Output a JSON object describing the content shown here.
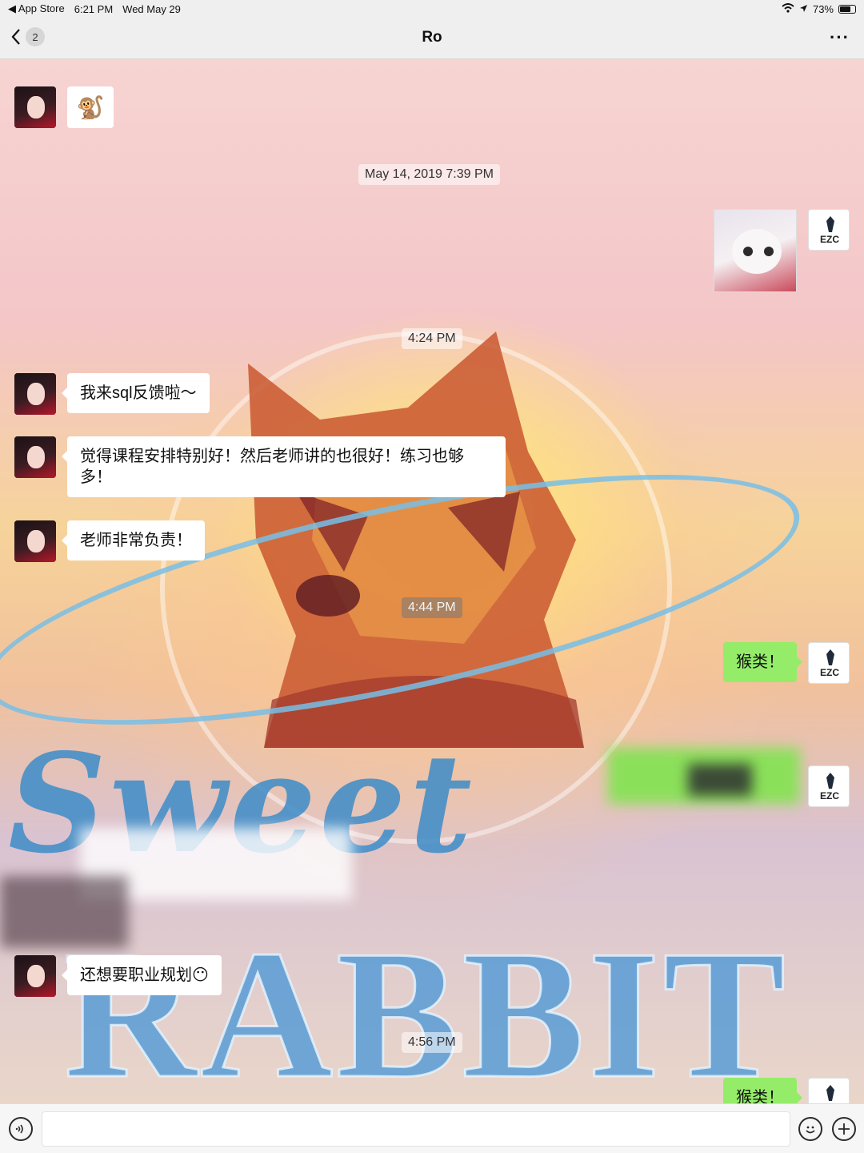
{
  "status_bar": {
    "back_app": "App Store",
    "time": "6:21 PM",
    "date": "Wed May 29",
    "battery": "73%",
    "battery_level": 0.73
  },
  "nav": {
    "title": "Ro",
    "unread_badge": "2",
    "more_label": "···"
  },
  "messages": {
    "sticker_1": "🐒",
    "timestamp_1": "May 14, 2019 7:39 PM",
    "timestamp_2": "4:24 PM",
    "msg_1": "我来sql反馈啦～",
    "msg_2": "觉得课程安排特别好！然后老师讲的也很好！练习也够多！",
    "msg_3": "老师非常负责！",
    "timestamp_3": "4:44 PM",
    "msg_4": "猴类！",
    "msg_5": "还想要职业规划😶",
    "timestamp_4": "4:56 PM",
    "msg_6": "猴类！",
    "my_avatar_text": "EZC"
  },
  "background": {
    "word_1": "Sweet",
    "word_2": "RABBIT"
  },
  "input_bar": {
    "placeholder": "",
    "voice_icon": "voice-icon",
    "emoji_icon": "emoji-icon",
    "plus_icon": "plus-icon"
  },
  "colors": {
    "bubble_green": "#95ec69",
    "bubble_white": "#ffffff"
  }
}
